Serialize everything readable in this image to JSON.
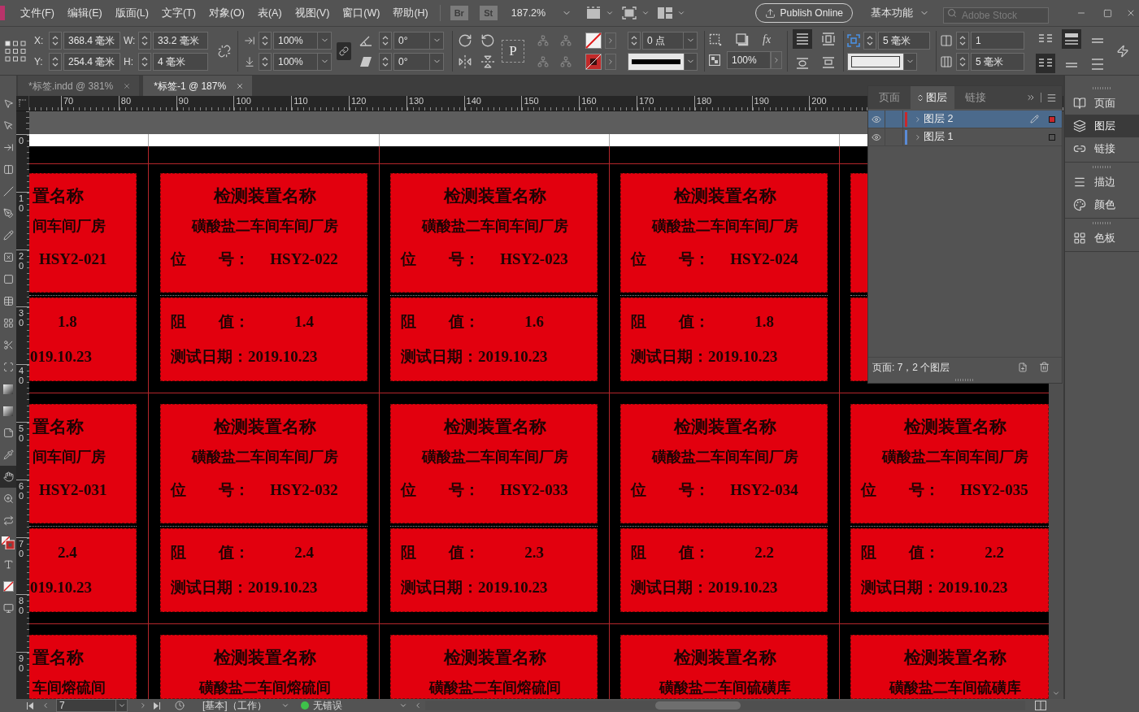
{
  "menu_bar": {
    "items": [
      "文件(F)",
      "编辑(E)",
      "版面(L)",
      "文字(T)",
      "对象(O)",
      "表(A)",
      "视图(V)",
      "窗口(W)",
      "帮助(H)"
    ],
    "bridge": "Br",
    "stock": "St",
    "zoom": "187.2%",
    "publish": "Publish Online",
    "workspace": "基本功能",
    "search": {
      "placeholder": "Adobe Stock"
    }
  },
  "control_panel": {
    "reference_points": [
      {
        "selected": true
      },
      {
        "selected": false
      },
      {
        "selected": false
      },
      {
        "selected": false
      },
      {
        "selected": false
      },
      {
        "selected": false
      },
      {
        "selected": false
      },
      {
        "selected": false
      },
      {
        "selected": false
      }
    ],
    "position": [
      {
        "label": "X:",
        "value": "368.4 毫米"
      },
      {
        "label": "Y:",
        "value": "254.4 毫米"
      }
    ],
    "size": [
      {
        "label": "W:",
        "value": "33.2 毫米"
      },
      {
        "label": "H:",
        "value": "4 毫米"
      }
    ],
    "scale": [
      "100%",
      "100%"
    ],
    "scale_linked": true,
    "angles": [
      "0°",
      "0°"
    ],
    "content_button": "P",
    "stroke_weight": "0 点",
    "effects_button": "fx",
    "opacity": "100%",
    "wrap_options": [
      {
        "selected": true
      },
      {
        "selected": false
      },
      {
        "selected": false
      },
      {
        "selected": false
      }
    ],
    "autofit_offset": "5 毫米",
    "columns": "1",
    "gutter": "5 毫米",
    "alignment_options": [
      {
        "selected": false
      },
      {
        "selected": true
      },
      {
        "selected": false
      },
      {
        "selected": true
      },
      {
        "selected": false
      },
      {
        "selected": false
      }
    ]
  },
  "tools": [
    {
      "selected": false
    },
    {
      "selected": false
    },
    {
      "selected": false
    },
    {
      "selected": false
    },
    {
      "selected": false
    },
    {
      "selected": false
    },
    {
      "selected": false
    },
    {
      "selected": false
    },
    {
      "selected": false
    },
    {
      "selected": false
    },
    {
      "selected": false
    },
    {
      "selected": false
    },
    {
      "selected": false
    },
    {
      "selected": false
    },
    {
      "selected": false
    },
    {
      "selected": false
    },
    {
      "selected": false
    },
    {
      "selected": true
    },
    {
      "selected": false
    },
    {
      "selected": false
    },
    {
      "selected": false
    },
    {
      "selected": false
    },
    {
      "selected": false
    },
    {
      "selected": false
    }
  ],
  "document_tabs": [
    {
      "label": "*标签.indd @ 381%",
      "selected": false
    },
    {
      "label": "*标签-1 @ 187%",
      "selected": true
    }
  ],
  "rulers": {
    "horizontal": [
      "70",
      "80",
      "90",
      "100",
      "110",
      "120",
      "130",
      "140",
      "150",
      "160",
      "170",
      "180",
      "190",
      "200"
    ],
    "vertical": [
      "0",
      "10",
      "20",
      "30",
      "40",
      "50",
      "60",
      "70",
      "80",
      "90"
    ]
  },
  "canvas": {
    "rows": [
      {
        "cards": [
          {
            "kind": "cut_left",
            "title": "置名称",
            "location": "间车间厂房",
            "id_value": "HSY2-021",
            "reading": "1.8",
            "date": "019.10.23"
          },
          {
            "kind": "full",
            "title": "检测装置名称",
            "location": "磺酸盐二车间车间厂房",
            "id_label": [
              "位",
              "号："
            ],
            "id_value": "HSY2-022",
            "reading_label": [
              "阻",
              "值："
            ],
            "reading": "1.4",
            "date": "测试日期：2019.10.23"
          },
          {
            "kind": "full",
            "title": "检测装置名称",
            "location": "磺酸盐二车间车间厂房",
            "id_label": [
              "位",
              "号："
            ],
            "id_value": "HSY2-023",
            "reading_label": [
              "阻",
              "值："
            ],
            "reading": "1.6",
            "date": "测试日期：2019.10.23"
          },
          {
            "kind": "full",
            "title": "检测装置名称",
            "location": "磺酸盐二车间车间厂房",
            "id_label": [
              "位",
              "号："
            ],
            "id_value": "HSY2-024",
            "reading_label": [
              "阻",
              "值："
            ],
            "reading": "1.8",
            "date": "测试日期：2019.10.23"
          },
          {
            "kind": "cut_right"
          }
        ]
      },
      {
        "cards": [
          {
            "kind": "cut_left",
            "title": "置名称",
            "location": "间车间厂房",
            "id_value": "HSY2-031",
            "reading": "2.4",
            "date": "019.10.23"
          },
          {
            "kind": "full",
            "title": "检测装置名称",
            "location": "磺酸盐二车间车间厂房",
            "id_label": [
              "位",
              "号："
            ],
            "id_value": "HSY2-032",
            "reading_label": [
              "阻",
              "值："
            ],
            "reading": "2.4",
            "date": "测试日期：2019.10.23"
          },
          {
            "kind": "full",
            "title": "检测装置名称",
            "location": "磺酸盐二车间车间厂房",
            "id_label": [
              "位",
              "号："
            ],
            "id_value": "HSY2-033",
            "reading_label": [
              "阻",
              "值："
            ],
            "reading": "2.3",
            "date": "测试日期：2019.10.23"
          },
          {
            "kind": "full",
            "title": "检测装置名称",
            "location": "磺酸盐二车间车间厂房",
            "id_label": [
              "位",
              "号："
            ],
            "id_value": "HSY2-034",
            "reading_label": [
              "阻",
              "值："
            ],
            "reading": "2.2",
            "date": "测试日期：2019.10.23"
          },
          {
            "kind": "full",
            "title": "检测装置名称",
            "location": "磺酸盐二车间车间厂房",
            "id_label": [
              "位",
              "号："
            ],
            "id_value": "HSY2-035",
            "reading_label": [
              "阻",
              "值："
            ],
            "reading": "2.2",
            "date": "测试日期：2019.10.23"
          }
        ]
      },
      {
        "cards": [
          {
            "kind": "cut_left",
            "title": "置名称",
            "location": "车间熔硫间"
          },
          {
            "kind": "full",
            "title": "检测装置名称",
            "location": "磺酸盐二车间熔硫间"
          },
          {
            "kind": "full",
            "title": "检测装置名称",
            "location": "磺酸盐二车间熔硫间"
          },
          {
            "kind": "full",
            "title": "检测装置名称",
            "location": "磺酸盐二车间硫磺库"
          },
          {
            "kind": "full",
            "title": "检测装置名称",
            "location": "磺酸盐二车间硫磺库"
          }
        ]
      }
    ]
  },
  "layers_panel": {
    "tabs": [
      {
        "label": "页面",
        "selected": false
      },
      {
        "label": "图层",
        "selected": true
      },
      {
        "label": "链接",
        "selected": false
      }
    ],
    "layers": [
      {
        "name": "图层 2",
        "color": "#c8282c",
        "selected": true,
        "visible": true,
        "has_selection": true
      },
      {
        "name": "图层 1",
        "color": "#5b8bd6",
        "selected": false,
        "visible": true,
        "has_selection": false
      }
    ],
    "footer": "页面: 7，2 个图层"
  },
  "dock": [
    {
      "items": [
        {
          "label": "页面",
          "selected": false
        },
        {
          "label": "图层",
          "selected": true
        },
        {
          "label": "链接",
          "selected": false
        }
      ]
    },
    {
      "items": [
        {
          "label": "描边",
          "selected": false
        },
        {
          "label": "颜色",
          "selected": false
        }
      ]
    },
    {
      "items": [
        {
          "label": "色板",
          "selected": false
        }
      ]
    }
  ],
  "status_bar": {
    "page": "7",
    "master": "[基本]（工作）",
    "preflight": "无错误"
  }
}
